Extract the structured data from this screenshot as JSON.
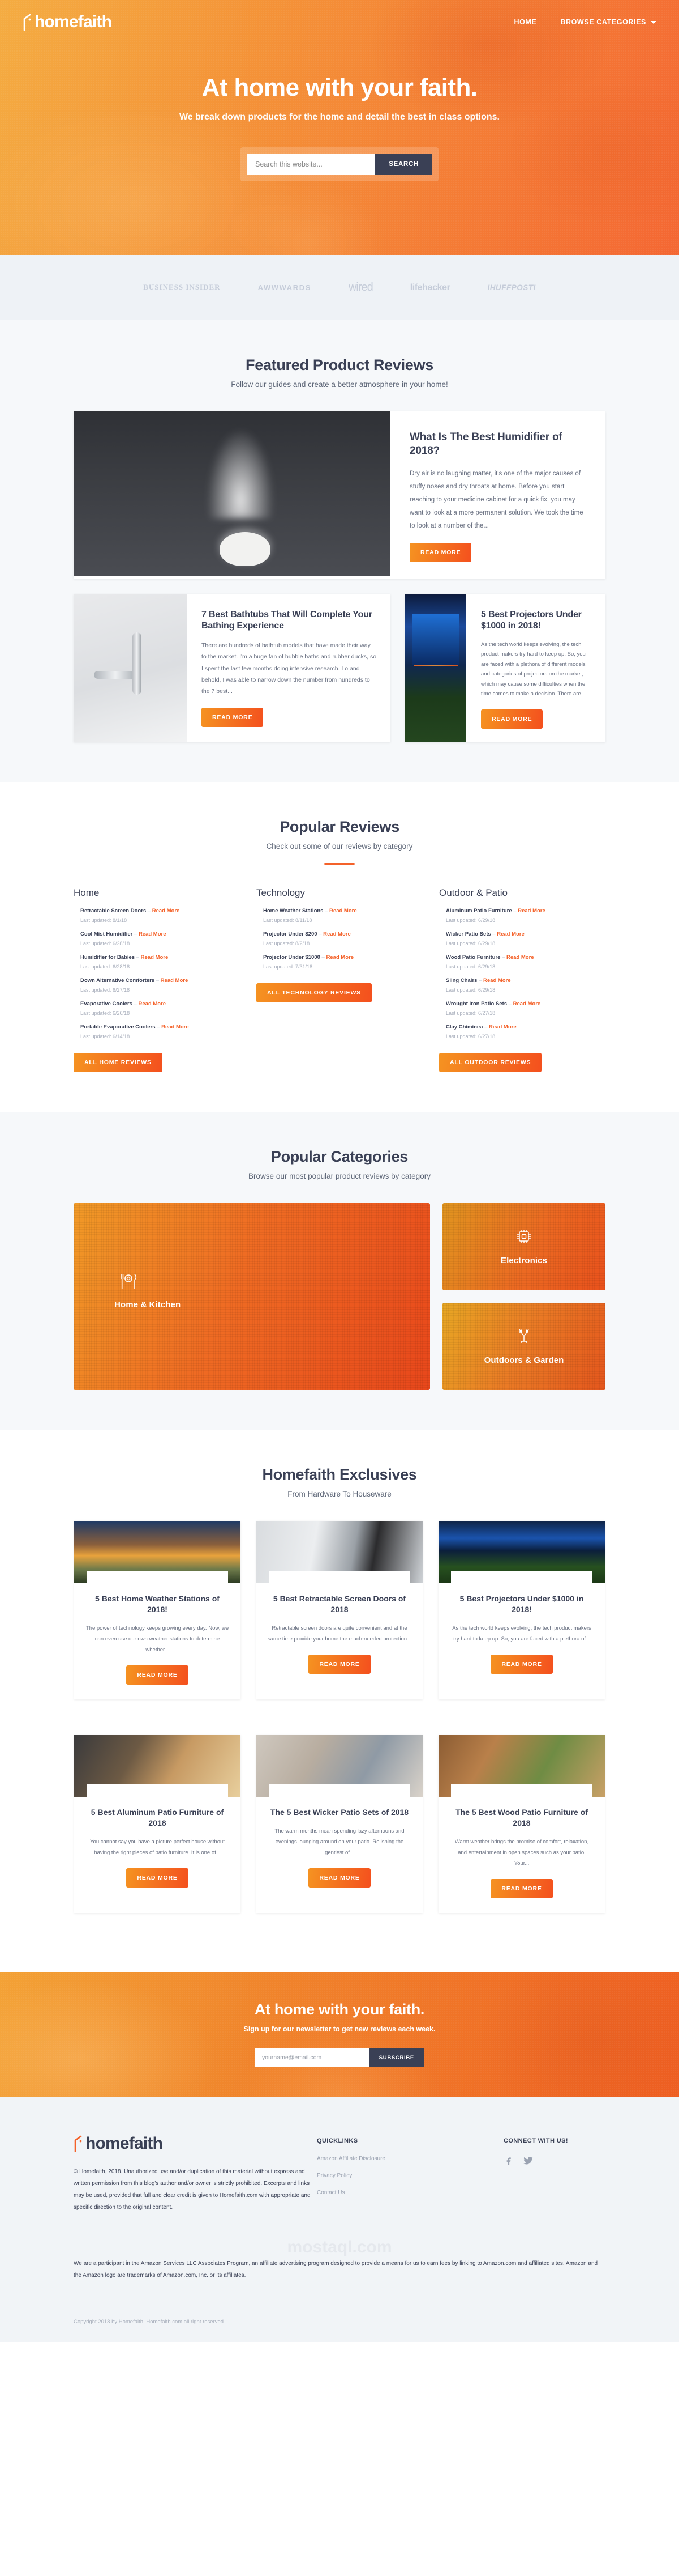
{
  "brand": {
    "name": "homefaith",
    "accent": "#f4622a",
    "dark": "#3a4055"
  },
  "nav": {
    "items": [
      {
        "label": "HOME",
        "name": "nav-home"
      },
      {
        "label": "BROWSE CATEGORIES",
        "name": "nav-browse-categories",
        "has_caret": true
      }
    ]
  },
  "hero": {
    "title": "At home with your faith.",
    "subtitle": "We break down products for the home and detail the best in class options.",
    "search_placeholder": "Search this website...",
    "search_value": "",
    "search_button": "SEARCH"
  },
  "press": {
    "items": [
      {
        "label": "BUSINESS INSIDER",
        "name": "press-logo-business-insider"
      },
      {
        "label": "AWWWARDS",
        "name": "press-logo-awwwards"
      },
      {
        "label": "wired",
        "name": "press-logo-wired"
      },
      {
        "label": "lifehacker",
        "name": "press-logo-lifehacker"
      },
      {
        "label": "IHUFFPOSTI",
        "name": "press-logo-huffpost"
      }
    ]
  },
  "featured": {
    "title": "Featured Product Reviews",
    "subtitle": "Follow our guides and create a better atmosphere in your home!",
    "big": {
      "title": "What Is The Best Humidifier of 2018?",
      "text": "Dry air is no laughing matter, it's one of the major causes of stuffy noses and dry throats at home. Before you start reaching to your medicine cabinet for a quick fix, you may want to look at a more permanent solution. We took the time to look at a number of the...",
      "button": "READ MORE"
    },
    "cards": [
      {
        "title": "7 Best Bathtubs That Will Complete Your Bathing Experience",
        "text": "There are hundreds of bathtub models that have made their way to the market. I'm a huge fan of bubble baths and rubber ducks, so I spent the last few months doing intensive research. Lo and behold, I was able to narrow down the number from hundreds to the 7 best...",
        "button": "READ MORE"
      },
      {
        "title": "5 Best Projectors Under $1000 in 2018!",
        "text": "As the tech world keeps evolving, the tech product makers try hard to keep up. So, you are faced with a plethora of different models and categories of projectors on the market, which may cause some difficulties when the time comes to make a decision. There are...",
        "button": "READ MORE"
      }
    ]
  },
  "popular_reviews": {
    "title": "Popular Reviews",
    "subtitle": "Check out some of our reviews by category",
    "read_more": "Read More",
    "dash": "–",
    "date_prefix": "Last updated: ",
    "columns": [
      {
        "title": "Home",
        "button": "ALL HOME REVIEWS",
        "items": [
          {
            "name": "Retractable Screen Doors",
            "date": "8/1/18"
          },
          {
            "name": "Cool Mist Humidifier",
            "date": "6/28/18"
          },
          {
            "name": "Humidifier for Babies",
            "date": "6/28/18"
          },
          {
            "name": "Down Alternative Comforters",
            "date": "6/27/18"
          },
          {
            "name": "Evaporative Coolers",
            "date": "6/26/18"
          },
          {
            "name": "Portable Evaporative Coolers",
            "date": "6/14/18"
          }
        ]
      },
      {
        "title": "Technology",
        "button": "ALL TECHNOLOGY REVIEWS",
        "items": [
          {
            "name": "Home Weather Stations",
            "date": "8/11/18"
          },
          {
            "name": "Projector Under $200",
            "date": "8/2/18"
          },
          {
            "name": "Projector Under $1000",
            "date": "7/31/18"
          }
        ]
      },
      {
        "title": "Outdoor & Patio",
        "button": "ALL OUTDOOR REVIEWS",
        "items": [
          {
            "name": "Aluminum Patio Furniture",
            "date": "6/29/18"
          },
          {
            "name": "Wicker Patio Sets",
            "date": "6/29/18"
          },
          {
            "name": "Wood Patio Furniture",
            "date": "6/29/18"
          },
          {
            "name": "Sling Chairs",
            "date": "6/29/18"
          },
          {
            "name": "Wrought Iron Patio Sets",
            "date": "6/27/18"
          },
          {
            "name": "Clay Chiminea",
            "date": "6/27/18"
          }
        ]
      }
    ]
  },
  "categories": {
    "title": "Popular Categories",
    "subtitle": "Browse our most popular product reviews by category",
    "items": [
      {
        "label": "Home & Kitchen",
        "icon": "cutlery-icon"
      },
      {
        "label": "Electronics",
        "icon": "cpu-chip-icon"
      },
      {
        "label": "Outdoors & Garden",
        "icon": "garden-tools-icon"
      }
    ]
  },
  "exclusives": {
    "title": "Homefaith Exclusives",
    "subtitle": "From Hardware To Houseware",
    "button": "READ MORE",
    "cards": [
      {
        "title": "5 Best Home Weather Stations of 2018!",
        "text": "The power of technology keeps growing every day. Now, we can even use our own weather stations to determine whether..."
      },
      {
        "title": "5 Best Retractable Screen Doors of 2018",
        "text": "Retractable screen doors are quite convenient and at the same time provide your home the much-needed protection..."
      },
      {
        "title": "5 Best Projectors Under $1000 in 2018!",
        "text": "As the tech world keeps evolving, the tech product makers try hard to keep up. So, you are faced with a plethora of..."
      },
      {
        "title": "5 Best Aluminum Patio Furniture of 2018",
        "text": "You cannot say you have a picture perfect house without having the right pieces of patio furniture. It is one of..."
      },
      {
        "title": "The 5 Best Wicker Patio Sets of 2018",
        "text": "The warm months mean spending lazy afternoons and evenings lounging around on your patio. Relishing the gentlest of..."
      },
      {
        "title": "The 5 Best Wood Patio Furniture of 2018",
        "text": "Warm weather brings the promise of comfort, relaxation, and entertainment in open spaces such as your patio. Your..."
      }
    ]
  },
  "newsletter": {
    "title": "At home with your faith.",
    "subtitle": "Sign up for our newsletter to get new reviews each week.",
    "placeholder": "yourname@email.com",
    "value": "",
    "button": "SUBSCRIBE"
  },
  "footer": {
    "logo": "homefaith",
    "copyright_block": "© Homefaith, 2018. Unauthorized use and/or duplication of this material without express and written permission from this blog's author and/or owner is strictly prohibited. Excerpts and links may be used, provided that full and clear credit is given to Homefaith.com with appropriate and specific direction to the original content.",
    "quicklinks_head": "QUICKLINKS",
    "quicklinks": [
      {
        "label": "Amazon Affiliate Disclosure"
      },
      {
        "label": "Privacy Policy"
      },
      {
        "label": "Contact Us"
      }
    ],
    "connect_head": "CONNECT WITH US!",
    "socials": [
      {
        "name": "facebook-icon",
        "glyph": "f"
      },
      {
        "name": "twitter-icon",
        "glyph": "t"
      }
    ],
    "amazon_disclaimer": "We are a participant in the Amazon Services LLC Associates Program, an affiliate advertising program designed to provide a means for us to earn fees by linking to Amazon.com and affiliated sites. Amazon and the Amazon logo are trademarks of Amazon.com, Inc. or its affiliates.",
    "bottom": "Copyright 2018 by Homefaith. Homefaith.com all right reserved.",
    "watermark": "mostaql.com"
  }
}
